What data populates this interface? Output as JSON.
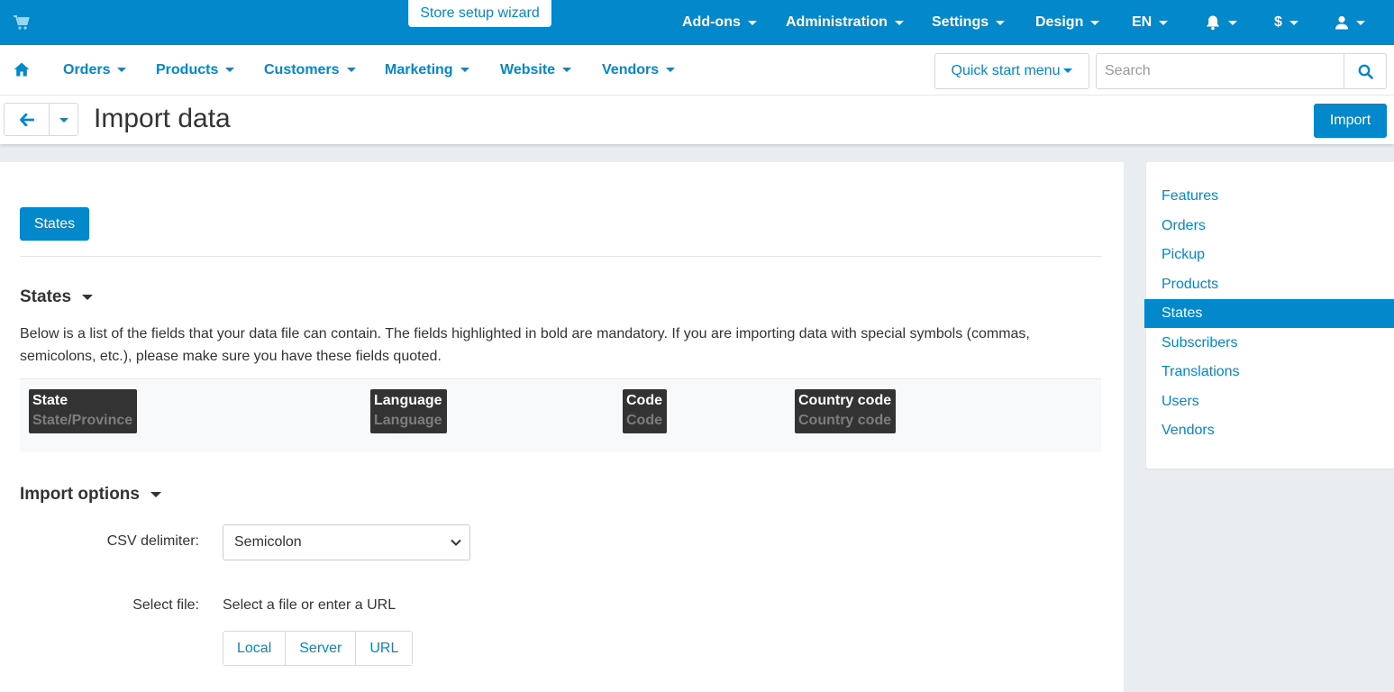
{
  "topbar": {
    "wizard": "Store setup wizard",
    "menu": [
      "Add-ons",
      "Administration",
      "Settings",
      "Design",
      "EN"
    ],
    "currency": "$",
    "icons": [
      "cart-icon",
      "bell-icon",
      "user-icon"
    ],
    "color": "#0388cc"
  },
  "nav": {
    "items": [
      "Orders",
      "Products",
      "Customers",
      "Marketing",
      "Website",
      "Vendors"
    ],
    "quick_start": "Quick start menu",
    "search_placeholder": "Search"
  },
  "header": {
    "title": "Import data",
    "import_button": "Import"
  },
  "main": {
    "tab_button": "States",
    "section_title": "States",
    "description": "Below is a list of the fields that your data file can contain. The fields highlighted in bold are mandatory. If you are importing data with special symbols (commas, semicolons, etc.), please make sure you have these fields quoted.",
    "fields": [
      {
        "name": "State",
        "alt": "State/Province"
      },
      {
        "name": "Language",
        "alt": "Language"
      },
      {
        "name": "Code",
        "alt": "Code"
      },
      {
        "name": "Country code",
        "alt": "Country code"
      }
    ],
    "options_title": "Import options",
    "csv_label": "CSV delimiter:",
    "csv_value": "Semicolon",
    "file_label": "Select file:",
    "file_hint": "Select a file or enter a URL",
    "file_sources": [
      "Local",
      "Server",
      "URL"
    ]
  },
  "sidebar": {
    "items": [
      "Features",
      "Orders",
      "Pickup",
      "Products",
      "States",
      "Subscribers",
      "Translations",
      "Users",
      "Vendors"
    ],
    "active": "States"
  }
}
